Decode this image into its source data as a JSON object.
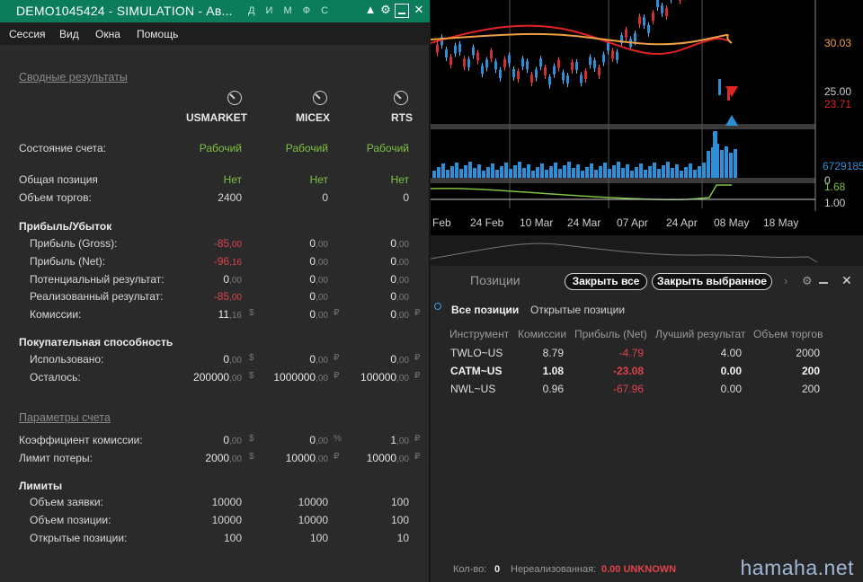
{
  "window": {
    "title": "DEMO1045424 - SIMULATION - Ав...",
    "header_letters": [
      "Д",
      "И",
      "М",
      "Ф",
      "С"
    ]
  },
  "menu": [
    "Сессия",
    "Вид",
    "Окна",
    "Помощь"
  ],
  "summary": {
    "section_title": "Сводные результаты",
    "columns": [
      "USMARKET",
      "MICEX",
      "RTS"
    ],
    "account_state_label": "Состояние счета:",
    "account_state": [
      "Рабочий",
      "Рабочий",
      "Рабочий"
    ],
    "total_position_label": "Общая позиция",
    "total_position": [
      "Нет",
      "Нет",
      "Нет"
    ],
    "volume_label": "Объем торгов:",
    "volume": [
      "2400",
      "0",
      "0"
    ],
    "pnl_title": "Прибыль/Убыток",
    "gross_label": "Прибыль (Gross):",
    "gross": [
      [
        "-85",
        ",00"
      ],
      [
        "0",
        ",00"
      ],
      [
        "0",
        ",00"
      ]
    ],
    "net_label": "Прибыль (Net):",
    "net": [
      [
        "-96",
        ",16"
      ],
      [
        "0",
        ",00"
      ],
      [
        "0",
        ",00"
      ]
    ],
    "potential_label": "Потенциальный результат:",
    "potential": [
      [
        "0",
        ",00"
      ],
      [
        "0",
        ",00"
      ],
      [
        "0",
        ",00"
      ]
    ],
    "realized_label": "Реализованный результат:",
    "realized": [
      [
        "-85",
        ",00"
      ],
      [
        "0",
        ",00"
      ],
      [
        "0",
        ",00"
      ]
    ],
    "commissions_label": "Комиссии:",
    "commissions": [
      [
        "11",
        ",16"
      ],
      [
        "0",
        ",00"
      ],
      [
        "0",
        ",00"
      ]
    ],
    "buying_title": "Покупательная способность",
    "used_label": "Использовано:",
    "used": [
      [
        "0",
        ",00"
      ],
      [
        "0",
        ",00"
      ],
      [
        "0",
        ",00"
      ]
    ],
    "left_label": "Осталось:",
    "left": [
      [
        "200000",
        ",00"
      ],
      [
        "1000000",
        ",00"
      ],
      [
        "100000",
        ",00"
      ]
    ],
    "units": [
      "$",
      "₽",
      "₽"
    ]
  },
  "params": {
    "section_title": "Параметры счета",
    "commission_coef_label": "Коэффициент комиссии:",
    "commission_coef": [
      [
        "0",
        ",00"
      ],
      [
        "0",
        ",00"
      ],
      [
        "1",
        ",00"
      ]
    ],
    "commission_units": [
      "$",
      "%",
      "₽"
    ],
    "loss_limit_label": "Лимит потеры:",
    "loss_limit": [
      [
        "2000",
        ",00"
      ],
      [
        "10000",
        ",00"
      ],
      [
        "10000",
        ",00"
      ]
    ],
    "loss_units": [
      "$",
      "₽",
      "₽"
    ],
    "limits_title": "Лимиты",
    "order_volume_label": "Объем заявки:",
    "order_volume": [
      "10000",
      "10000",
      "100"
    ],
    "position_volume_label": "Объем позиции:",
    "position_volume": [
      "10000",
      "10000",
      "100"
    ],
    "open_positions_label": "Открытые позиции:",
    "open_positions": [
      "100",
      "100",
      "10"
    ]
  },
  "chart": {
    "price_labels": [
      "30.03",
      "25.00",
      "23.71"
    ],
    "volume_label": "6729185",
    "indicator_labels": [
      "0",
      "1.68",
      "1.00"
    ],
    "date_labels": [
      "Feb",
      "24 Feb",
      "10 Mar",
      "24 Mar",
      "07 Apr",
      "24 Apr",
      "08 May",
      "18 May"
    ],
    "colors": {
      "ma_red": "#e02424",
      "ma_orange": "#f0a040",
      "volume": "#2f8fd6",
      "indicator": "#7dc240"
    }
  },
  "positions": {
    "panel_title": "Позиции",
    "close_all": "Закрыть все",
    "close_selected": "Закрыть выбранное",
    "tab_all": "Все позиции",
    "tab_open": "Открытые позиции",
    "columns": [
      "Инструмент",
      "Комиссии",
      "Прибыль (Net)",
      "Лучший результат",
      "Объем торгов"
    ],
    "rows": [
      {
        "instrument": "TWLO~US",
        "commission": "8.79",
        "net": "-4.79",
        "best": "4.00",
        "volume": "2000",
        "bold": false
      },
      {
        "instrument": "CATM~US",
        "commission": "1.08",
        "net": "-23.08",
        "best": "0.00",
        "volume": "200",
        "bold": true
      },
      {
        "instrument": "NWL~US",
        "commission": "0.96",
        "net": "-67.96",
        "best": "0.00",
        "volume": "200",
        "bold": false
      }
    ],
    "footer_count_label": "Кол-во:",
    "footer_count": "0",
    "footer_unrealized_label": "Нереализованная:",
    "footer_unrealized": "0.00 UNKNOWN"
  },
  "watermark": "hamaha.net"
}
